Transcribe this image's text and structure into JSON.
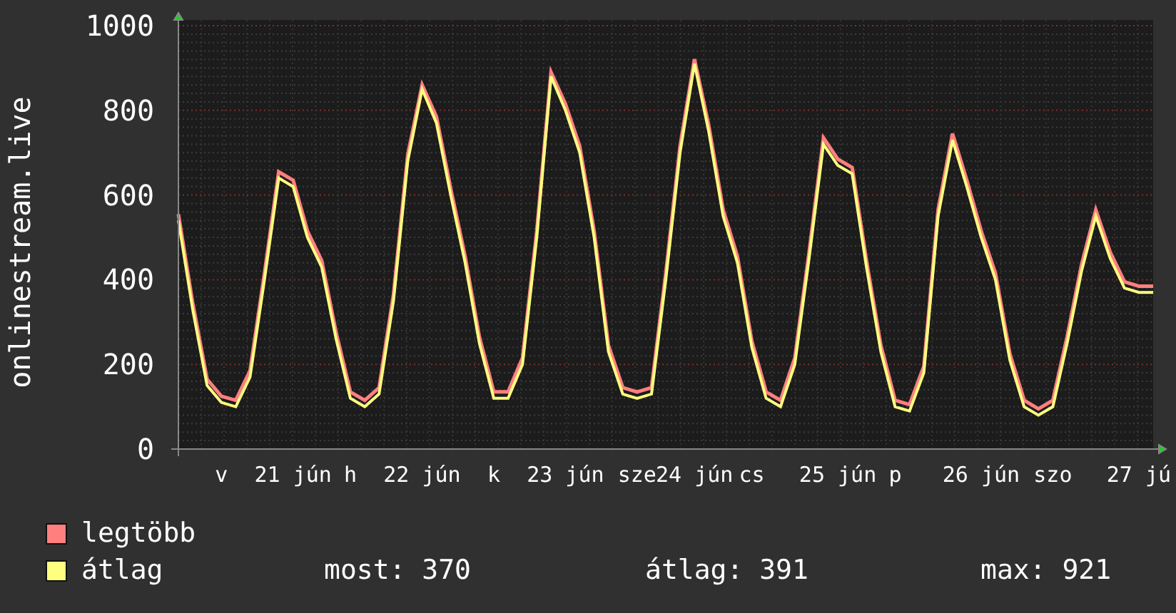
{
  "chart": {
    "chart_data": {
      "type": "line",
      "grid": true,
      "ylabel": "onlinestream.live",
      "ylim": [
        0,
        1000
      ],
      "yticks": [
        0,
        200,
        400,
        600,
        800,
        1000
      ],
      "categories": [
        null,
        null,
        null,
        "v",
        null,
        null,
        null,
        null,
        "21 jún",
        null,
        null,
        null,
        "h",
        null,
        null,
        null,
        null,
        "22 jún",
        null,
        null,
        null,
        null,
        "k",
        null,
        null,
        null,
        null,
        "23 jún",
        null,
        null,
        null,
        null,
        "sze",
        null,
        null,
        null,
        "24 jún",
        null,
        null,
        null,
        "cs",
        null,
        null,
        null,
        null,
        null,
        "25 jún",
        null,
        null,
        null,
        "p",
        null,
        null,
        null,
        null,
        null,
        "26 jún",
        null,
        null,
        null,
        null,
        "szo",
        null,
        null,
        null,
        null,
        null,
        "27 jú",
        null
      ],
      "series": [
        {
          "name": "legtöbb",
          "color": "#ff7f7f",
          "values": [
            555,
            345,
            165,
            125,
            115,
            185,
            415,
            655,
            635,
            515,
            445,
            275,
            135,
            115,
            145,
            365,
            695,
            860,
            785,
            615,
            455,
            265,
            135,
            135,
            215,
            515,
            890,
            815,
            715,
            515,
            245,
            145,
            135,
            145,
            415,
            715,
            921,
            765,
            565,
            455,
            255,
            135,
            115,
            215,
            465,
            735,
            685,
            665,
            445,
            245,
            115,
            105,
            195,
            565,
            745,
            635,
            515,
            415,
            225,
            115,
            95,
            115,
            265,
            435,
            565,
            465,
            395,
            385,
            385
          ]
        },
        {
          "name": "átlag",
          "color": "#ffff7f",
          "values": [
            540,
            330,
            150,
            110,
            100,
            170,
            400,
            640,
            620,
            500,
            430,
            260,
            120,
            100,
            130,
            350,
            680,
            850,
            770,
            600,
            440,
            250,
            120,
            120,
            200,
            500,
            880,
            800,
            700,
            500,
            230,
            130,
            120,
            130,
            400,
            700,
            910,
            750,
            550,
            440,
            240,
            120,
            100,
            200,
            450,
            720,
            670,
            650,
            430,
            230,
            100,
            90,
            180,
            550,
            730,
            620,
            500,
            400,
            210,
            100,
            80,
            100,
            250,
            420,
            550,
            450,
            380,
            370,
            370
          ]
        }
      ]
    }
  },
  "legend_stats": [
    "most: 370",
    "átlag: 391",
    "max: 921"
  ]
}
